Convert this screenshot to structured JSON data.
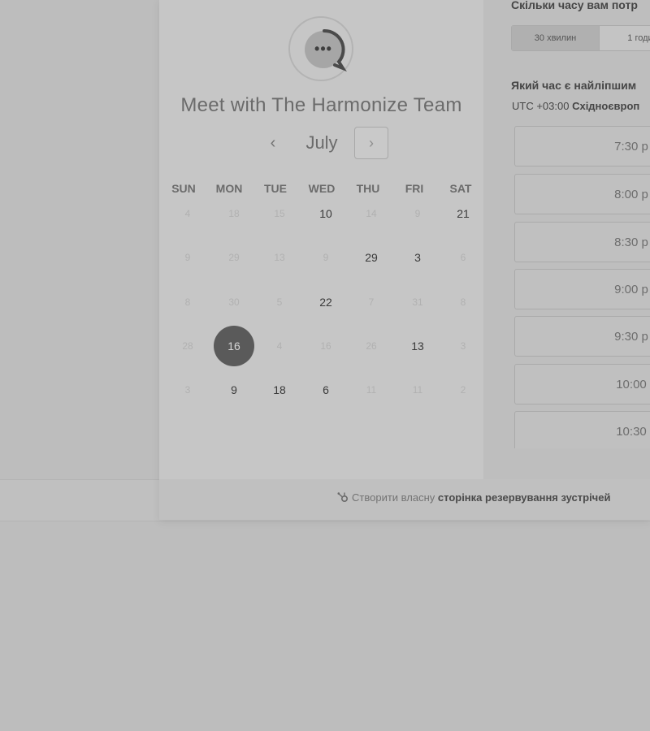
{
  "booking": {
    "title": "Meet with The Harmonize Team",
    "avatar_icon": "chat-bubble-dots",
    "month": "July",
    "prev_icon": "chevron-left",
    "next_icon": "chevron-right",
    "weekdays": [
      "SUN",
      "MON",
      "TUE",
      "WED",
      "THU",
      "FRI",
      "SAT"
    ],
    "weeks": [
      [
        {
          "d": "4",
          "a": false
        },
        {
          "d": "18",
          "a": false
        },
        {
          "d": "15",
          "a": false
        },
        {
          "d": "10",
          "a": true
        },
        {
          "d": "14",
          "a": false
        },
        {
          "d": "9",
          "a": false
        },
        {
          "d": "21",
          "a": true
        }
      ],
      [
        {
          "d": "9",
          "a": false
        },
        {
          "d": "29",
          "a": false
        },
        {
          "d": "13",
          "a": false
        },
        {
          "d": "9",
          "a": false
        },
        {
          "d": "29",
          "a": true
        },
        {
          "d": "3",
          "a": true
        },
        {
          "d": "6",
          "a": false
        }
      ],
      [
        {
          "d": "8",
          "a": false
        },
        {
          "d": "30",
          "a": false
        },
        {
          "d": "5",
          "a": false
        },
        {
          "d": "22",
          "a": true
        },
        {
          "d": "7",
          "a": false
        },
        {
          "d": "31",
          "a": false
        },
        {
          "d": "8",
          "a": false
        }
      ],
      [
        {
          "d": "28",
          "a": false
        },
        {
          "d": "16",
          "a": true,
          "sel": true
        },
        {
          "d": "4",
          "a": false
        },
        {
          "d": "16",
          "a": false
        },
        {
          "d": "26",
          "a": false
        },
        {
          "d": "13",
          "a": true
        },
        {
          "d": "3",
          "a": false
        }
      ],
      [
        {
          "d": "3",
          "a": false
        },
        {
          "d": "9",
          "a": true
        },
        {
          "d": "18",
          "a": true
        },
        {
          "d": "6",
          "a": true
        },
        {
          "d": "11",
          "a": false
        },
        {
          "d": "11",
          "a": false
        },
        {
          "d": "2",
          "a": false
        }
      ]
    ],
    "selected_day": "16"
  },
  "right": {
    "duration_question": "Скільки часу вам потр",
    "durations": [
      "30 хвилин",
      "1 годи"
    ],
    "selected_duration": "30 хвилин",
    "time_question": "Який час є найліпшим",
    "timezone_offset": "UTC +03:00",
    "timezone_name": "Східноєвроп",
    "slots": [
      "7:30 p",
      "8:00 p",
      "8:30 p",
      "9:00 p",
      "9:30 p",
      "10:00",
      "10:30"
    ]
  },
  "footer": {
    "prefix": "Створити власну",
    "link": "сторінка резервування зустрічей",
    "icon": "hubspot-sprocket"
  }
}
